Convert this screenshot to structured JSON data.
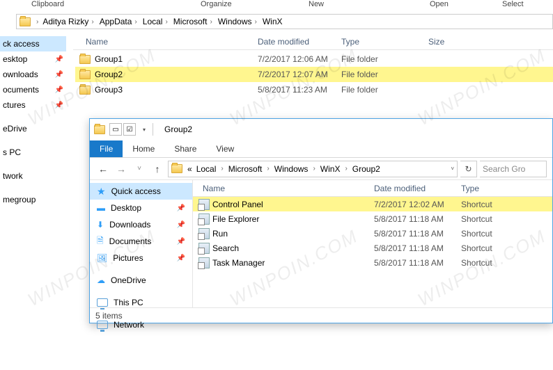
{
  "back": {
    "ribbon": {
      "clipboard": "Clipboard",
      "organize": "Organize",
      "new": "New",
      "open": "Open",
      "select": "Select"
    },
    "breadcrumb": [
      "Aditya Rizky",
      "AppData",
      "Local",
      "Microsoft",
      "Windows",
      "WinX"
    ],
    "sidebar": [
      {
        "label": "ck access",
        "selected": true,
        "pinned": false
      },
      {
        "label": "esktop",
        "pinned": true
      },
      {
        "label": "ownloads",
        "pinned": true
      },
      {
        "label": "ocuments",
        "pinned": true
      },
      {
        "label": "ctures",
        "pinned": true
      },
      {
        "label": "eDrive",
        "pinned": false,
        "gap": true
      },
      {
        "label": "s PC",
        "pinned": false,
        "gap": true
      },
      {
        "label": "twork",
        "pinned": false,
        "gap": true
      },
      {
        "label": "megroup",
        "pinned": false,
        "gap": true
      }
    ],
    "columns": {
      "name": "Name",
      "date": "Date modified",
      "type": "Type",
      "size": "Size"
    },
    "rows": [
      {
        "name": "Group1",
        "date": "7/2/2017 12:06 AM",
        "type": "File folder",
        "hl": false
      },
      {
        "name": "Group2",
        "date": "7/2/2017 12:07 AM",
        "type": "File folder",
        "hl": true
      },
      {
        "name": "Group3",
        "date": "5/8/2017 11:23 AM",
        "type": "File folder",
        "hl": false
      }
    ]
  },
  "front": {
    "title": "Group2",
    "tabs": {
      "file": "File",
      "home": "Home",
      "share": "Share",
      "view": "View"
    },
    "breadcrumb_prefix": "«",
    "breadcrumb": [
      "Local",
      "Microsoft",
      "Windows",
      "WinX",
      "Group2"
    ],
    "search_placeholder": "Search Gro",
    "sidebar": [
      {
        "label": "Quick access",
        "icon": "star",
        "selected": true,
        "pinned": false
      },
      {
        "label": "Desktop",
        "icon": "desktop",
        "pinned": true
      },
      {
        "label": "Downloads",
        "icon": "down",
        "pinned": true
      },
      {
        "label": "Documents",
        "icon": "doc",
        "pinned": true
      },
      {
        "label": "Pictures",
        "icon": "pic",
        "pinned": true
      },
      {
        "label": "OneDrive",
        "icon": "cloud",
        "pinned": false,
        "gap": true
      },
      {
        "label": "This PC",
        "icon": "pc",
        "pinned": false,
        "gap": true
      },
      {
        "label": "Network",
        "icon": "net",
        "pinned": false,
        "gap": true
      }
    ],
    "columns": {
      "name": "Name",
      "date": "Date modified",
      "type": "Type"
    },
    "rows": [
      {
        "name": "Control Panel",
        "date": "7/2/2017 12:02 AM",
        "type": "Shortcut",
        "hl": true
      },
      {
        "name": "File Explorer",
        "date": "5/8/2017 11:18 AM",
        "type": "Shortcut"
      },
      {
        "name": "Run",
        "date": "5/8/2017 11:18 AM",
        "type": "Shortcut"
      },
      {
        "name": "Search",
        "date": "5/8/2017 11:18 AM",
        "type": "Shortcut"
      },
      {
        "name": "Task Manager",
        "date": "5/8/2017 11:18 AM",
        "type": "Shortcut"
      }
    ],
    "status": "5 items"
  },
  "watermark": "WINPOIN.COM"
}
